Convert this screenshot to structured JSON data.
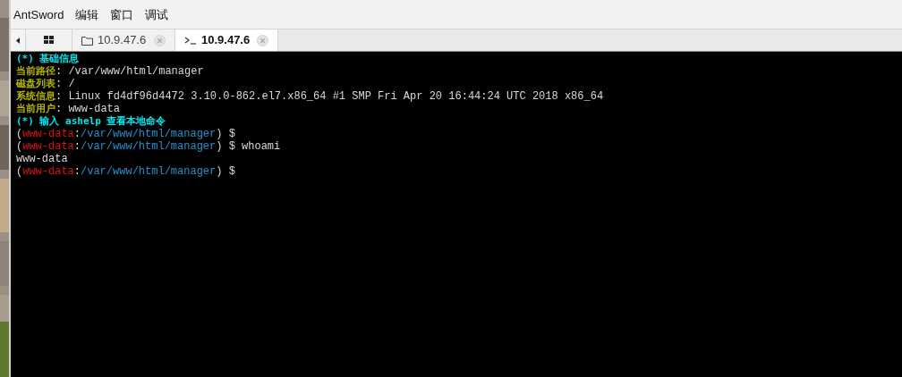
{
  "menu": [
    "AntSword",
    "编辑",
    "窗口",
    "调试"
  ],
  "tabs": [
    {
      "kind": "home",
      "selected": false
    },
    {
      "kind": "folder",
      "label": "10.9.47.6",
      "selected": false
    },
    {
      "kind": "terminal",
      "label": "10.9.47.6",
      "selected": true
    }
  ],
  "terminal": {
    "lines": [
      [
        {
          "kind": "heading",
          "text": "(*) 基础信息"
        }
      ],
      [
        {
          "kind": "label",
          "text": "当前路径"
        },
        {
          "kind": "plain",
          "text": ": /var/www/html/manager"
        }
      ],
      [
        {
          "kind": "label",
          "text": "磁盘列表"
        },
        {
          "kind": "plain",
          "text": ": /"
        }
      ],
      [
        {
          "kind": "label",
          "text": "系统信息"
        },
        {
          "kind": "plain",
          "text": ": Linux fd4df96d4472 3.10.0-862.el7.x86_64 #1 SMP Fri Apr 20 16:44:24 UTC 2018 x86_64"
        }
      ],
      [
        {
          "kind": "label",
          "text": "当前用户"
        },
        {
          "kind": "plain",
          "text": ": www-data"
        }
      ],
      [
        {
          "kind": "heading",
          "text": "(*) 输入 ashelp 查看本地命令"
        }
      ],
      [
        {
          "kind": "plain",
          "text": "("
        },
        {
          "kind": "user",
          "text": "www-data"
        },
        {
          "kind": "plain",
          "text": ":"
        },
        {
          "kind": "path",
          "text": "/var/www/html/manager"
        },
        {
          "kind": "plain",
          "text": ") $"
        }
      ],
      [
        {
          "kind": "plain",
          "text": "("
        },
        {
          "kind": "user",
          "text": "www-data"
        },
        {
          "kind": "plain",
          "text": ":"
        },
        {
          "kind": "path",
          "text": "/var/www/html/manager"
        },
        {
          "kind": "plain",
          "text": ") $ whoami"
        }
      ],
      [
        {
          "kind": "plain",
          "text": "www-data"
        }
      ],
      [
        {
          "kind": "plain",
          "text": "("
        },
        {
          "kind": "user",
          "text": "www-data"
        },
        {
          "kind": "plain",
          "text": ":"
        },
        {
          "kind": "path",
          "text": "/var/www/html/manager"
        },
        {
          "kind": "plain",
          "text": ") $"
        }
      ]
    ]
  }
}
